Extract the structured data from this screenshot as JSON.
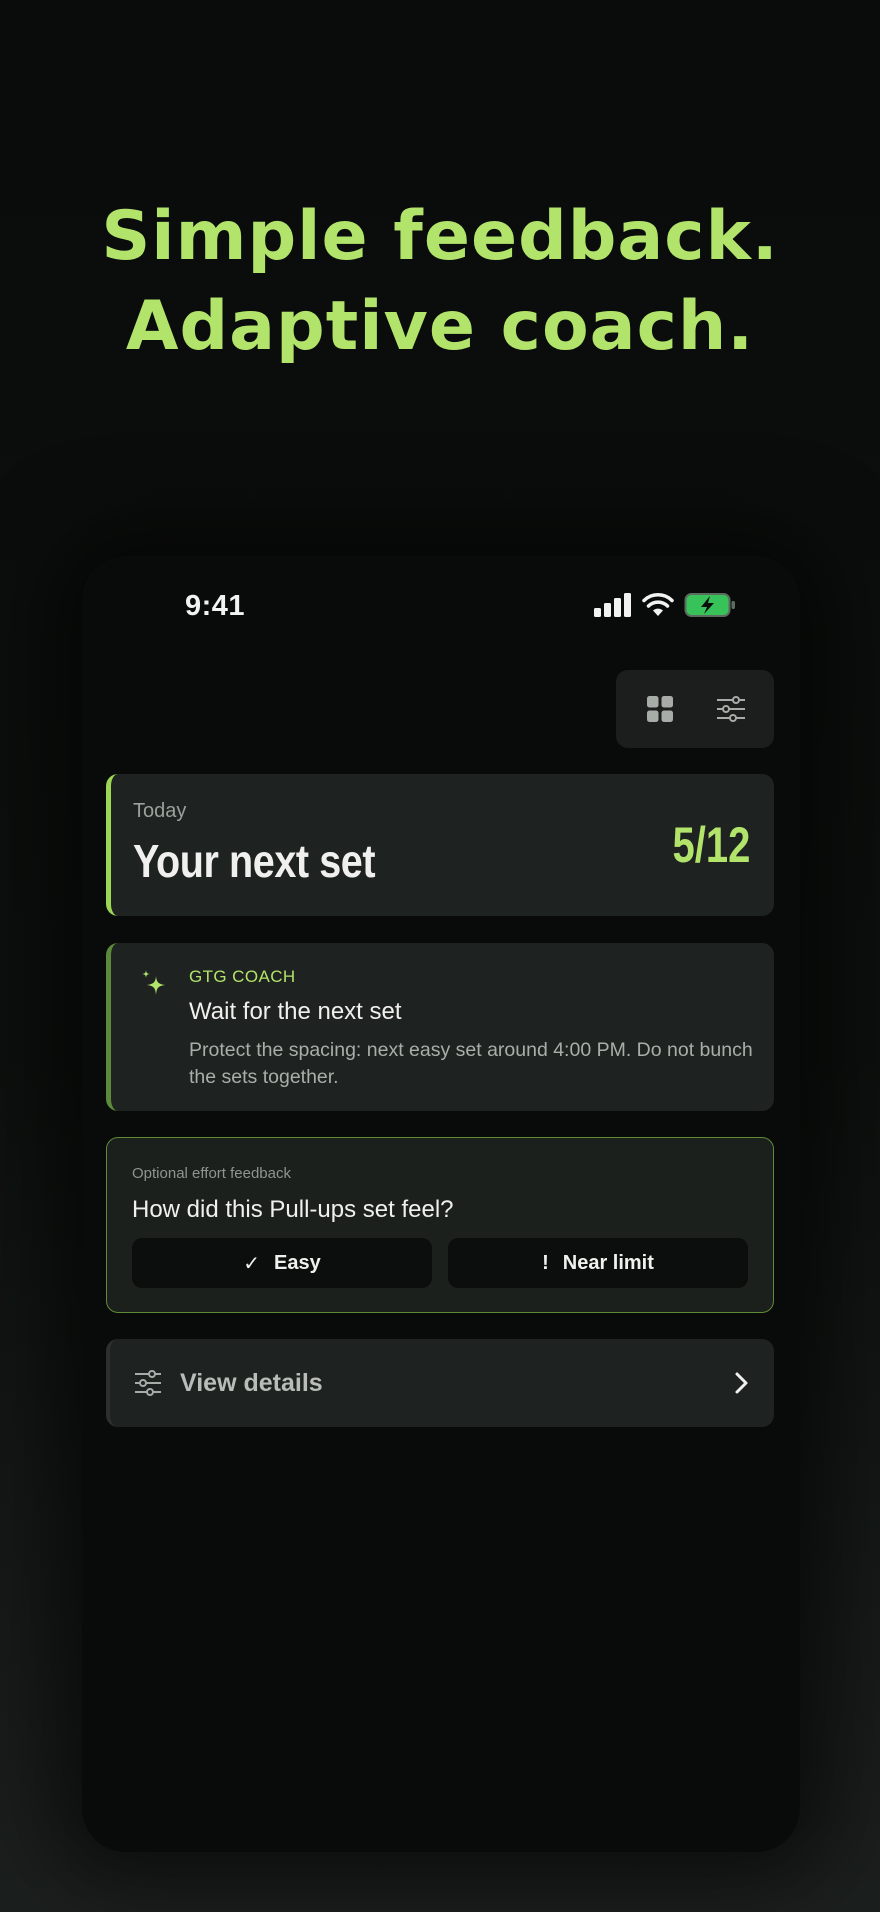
{
  "headline": {
    "line1": "Simple feedback.",
    "line2": "Adaptive coach."
  },
  "status_bar": {
    "time": "9:41",
    "icons": [
      "signal-icon",
      "wifi-icon",
      "battery-charging-icon"
    ]
  },
  "toolbar": {
    "icons": [
      "grid-icon",
      "sliders-icon"
    ]
  },
  "today_card": {
    "label": "Today",
    "title": "Your next set",
    "progress": "5/12"
  },
  "coach_card": {
    "label": "GTG COACH",
    "title": "Wait for the next set",
    "body": "Protect the spacing: next easy set around 4:00 PM. Do not bunch the sets together."
  },
  "feedback_card": {
    "label": "Optional effort feedback",
    "question": "How did this Pull-ups set feel?",
    "easy_label": "Easy",
    "easy_glyph": "✓",
    "limit_label": "Near limit",
    "limit_glyph": "!"
  },
  "details_card": {
    "label": "View details"
  },
  "colors": {
    "accent": "#b2e36b",
    "card": "#1e2220",
    "background": "#0b0d0c"
  }
}
